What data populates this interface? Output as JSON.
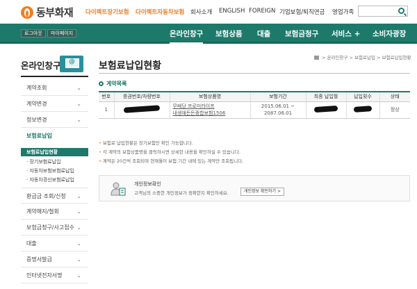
{
  "header": {
    "logo_text": "동부화재",
    "links_orange": [
      "다이렉트장기보험",
      "다이렉트자동차보험"
    ],
    "links_dark": [
      "회사소개",
      "ENGLISH",
      "FOREIGN",
      "기업보험/퇴직연금",
      "영업가족"
    ]
  },
  "gnb": {
    "buttons": [
      "로그아웃",
      "마이페이지"
    ],
    "items": [
      "온라인창구",
      "보험상품",
      "대출",
      "보험금청구",
      "서비스 +",
      "소비자광장"
    ]
  },
  "lnb": {
    "title": "온라인창구",
    "items": [
      "계약조회",
      "계약변경",
      "정보변경",
      "보험료납입",
      "환급금 조회/신청",
      "계약해지/철회",
      "보험금청구/사고접수",
      "대출",
      "증명서발급",
      "인터넷전자서명"
    ],
    "subitems": [
      "보험료납입현황",
      "장기보험료납입",
      "자동차보험보험료납입",
      "자동차경신보험료납입"
    ]
  },
  "content": {
    "title": "보험료납입현황",
    "breadcrumb": [
      "온라인창구",
      "보험료납입",
      "보험료납입현황"
    ],
    "section_title": "계약목록",
    "table": {
      "headers": [
        "번호",
        "증권번호/차량번호",
        "보험상품명",
        "보험기간",
        "최종 납입월",
        "납입횟수",
        "상태"
      ],
      "row": {
        "no": "1",
        "product_line1": "무배당 프로미라이프",
        "product_line2": "내생애든든종합보험1506",
        "period_start": "2015.06.01 ~",
        "period_end": "2087.06.01",
        "status": "정상"
      }
    },
    "notes": [
      "보험료 납입현황은 장기보험만 확인 가능합니다.",
      "각 계약의 보험상품명을 클릭하시면 상세한 내용을 확인하실 수 있습니다.",
      "계약은 20건씩 조회되며 현재월이 보험 기간 내에 있는 계약만 조회됩니다."
    ],
    "privacy": {
      "title": "개인정보확인",
      "description": "고객님의 소중한 개인정보가 정확한지 확인하세요.",
      "button": "개인정보 확인하기 >"
    }
  }
}
